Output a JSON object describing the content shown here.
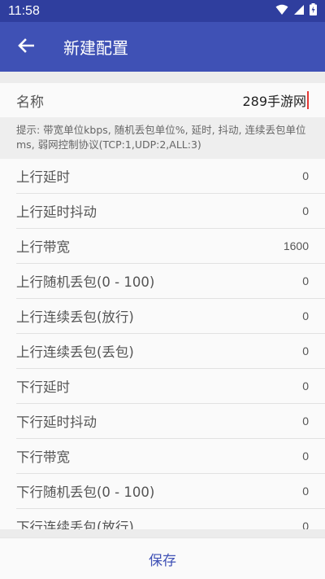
{
  "status_bar": {
    "time": "11:58",
    "icons": [
      "wifi-icon",
      "signal-icon",
      "battery-charging-icon"
    ]
  },
  "app_bar": {
    "back_icon": "arrow-back-icon",
    "title": "新建配置"
  },
  "name_field": {
    "label": "名称",
    "value": "289手游网"
  },
  "hint": {
    "text": "提示: 带宽单位kbps, 随机丢包单位%, 延时, 抖动, 连续丢包单位ms, 弱网控制协议(TCP:1,UDP:2,ALL:3)"
  },
  "settings": [
    {
      "label": "上行延时",
      "value": "0"
    },
    {
      "label": "上行延时抖动",
      "value": "0"
    },
    {
      "label": "上行带宽",
      "value": "1600"
    },
    {
      "label": "上行随机丢包(0 - 100)",
      "value": "0"
    },
    {
      "label": "上行连续丢包(放行)",
      "value": "0"
    },
    {
      "label": "上行连续丢包(丢包)",
      "value": "0"
    },
    {
      "label": "下行延时",
      "value": "0"
    },
    {
      "label": "下行延时抖动",
      "value": "0"
    },
    {
      "label": "下行带宽",
      "value": "0"
    },
    {
      "label": "下行随机丢包(0 - 100)",
      "value": "0"
    },
    {
      "label": "下行连续丢包(放行)",
      "value": "0"
    }
  ],
  "footer": {
    "save_label": "保存"
  },
  "colors": {
    "status_bar": "#2f3e9e",
    "app_bar": "#3f51b5",
    "accent": "#3f51b5",
    "caret": "#e53935"
  }
}
